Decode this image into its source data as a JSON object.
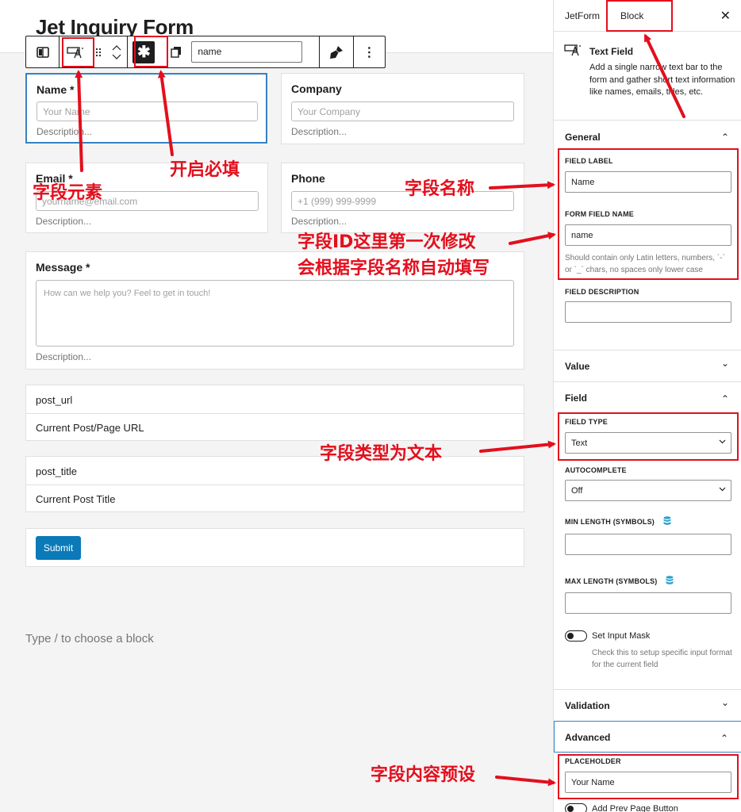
{
  "editor": {
    "form_title": "Jet Inquiry Form",
    "toolbar": {
      "field_name_value": "name",
      "required_symbol": "✱",
      "more_symbol": "⋮"
    },
    "fields": {
      "name": {
        "label": "Name *",
        "placeholder": "Your Name",
        "description": "Description..."
      },
      "company": {
        "label": "Company",
        "placeholder": "Your Company",
        "description": "Description..."
      },
      "email": {
        "label": "Email *",
        "placeholder": "yourname@email.com",
        "description": "Description..."
      },
      "phone": {
        "label": "Phone",
        "placeholder": "+1 (999) 999-9999",
        "description": "Description..."
      },
      "message": {
        "label": "Message *",
        "placeholder": "How can we help you? Feel to get in touch!",
        "description": "Description..."
      }
    },
    "hidden_fields": [
      {
        "name": "post_url",
        "value": "Current Post/Page URL"
      },
      {
        "name": "post_title",
        "value": "Current Post Title"
      }
    ],
    "submit_label": "Submit",
    "type_hint": "Type / to choose a block"
  },
  "sidebar": {
    "tabs": {
      "jetform": "JetForm",
      "block": "Block"
    },
    "close_symbol": "✕",
    "block": {
      "name": "Text Field",
      "description": "Add a single narrow text bar to the form and gather short text information like names, emails, titles, etc."
    },
    "panels": {
      "general": "General",
      "value": "Value",
      "field": "Field",
      "validation": "Validation",
      "advanced": "Advanced"
    },
    "chevron_up": "⌃",
    "chevron_down": "⌄",
    "general": {
      "field_label_title": "FIELD LABEL",
      "field_label_value": "Name",
      "form_field_name_title": "FORM FIELD NAME",
      "form_field_name_value": "name",
      "form_field_name_help": "Should contain only Latin letters, numbers, `-` or `_` chars, no spaces only lower case",
      "field_description_title": "FIELD DESCRIPTION",
      "field_description_value": ""
    },
    "field": {
      "field_type_title": "FIELD TYPE",
      "field_type_value": "Text",
      "autocomplete_title": "AUTOCOMPLETE",
      "autocomplete_value": "Off",
      "min_length_title": "MIN LENGTH (SYMBOLS)",
      "max_length_title": "MAX LENGTH (SYMBOLS)",
      "input_mask_label": "Set Input Mask",
      "input_mask_help": "Check this to setup specific input format for the current field"
    },
    "advanced": {
      "placeholder_title": "PLACEHOLDER",
      "placeholder_value": "Your Name",
      "prev_page_label": "Add Prev Page Button"
    }
  },
  "annotations": {
    "field_element": "字段元素",
    "enable_required": "开启必填",
    "field_name": "字段名称",
    "field_id_line1": "字段ID这里第一次修改",
    "field_id_line2": "会根据字段名称自动填写",
    "field_type_text": "字段类型为文本",
    "placeholder_preset": "字段内容预设"
  },
  "colors": {
    "annotation_red": "#e30f1d",
    "selection_blue": "#3582c4",
    "submit_blue": "#0a7ab8",
    "db_icon_blue": "#2ea2cc"
  }
}
